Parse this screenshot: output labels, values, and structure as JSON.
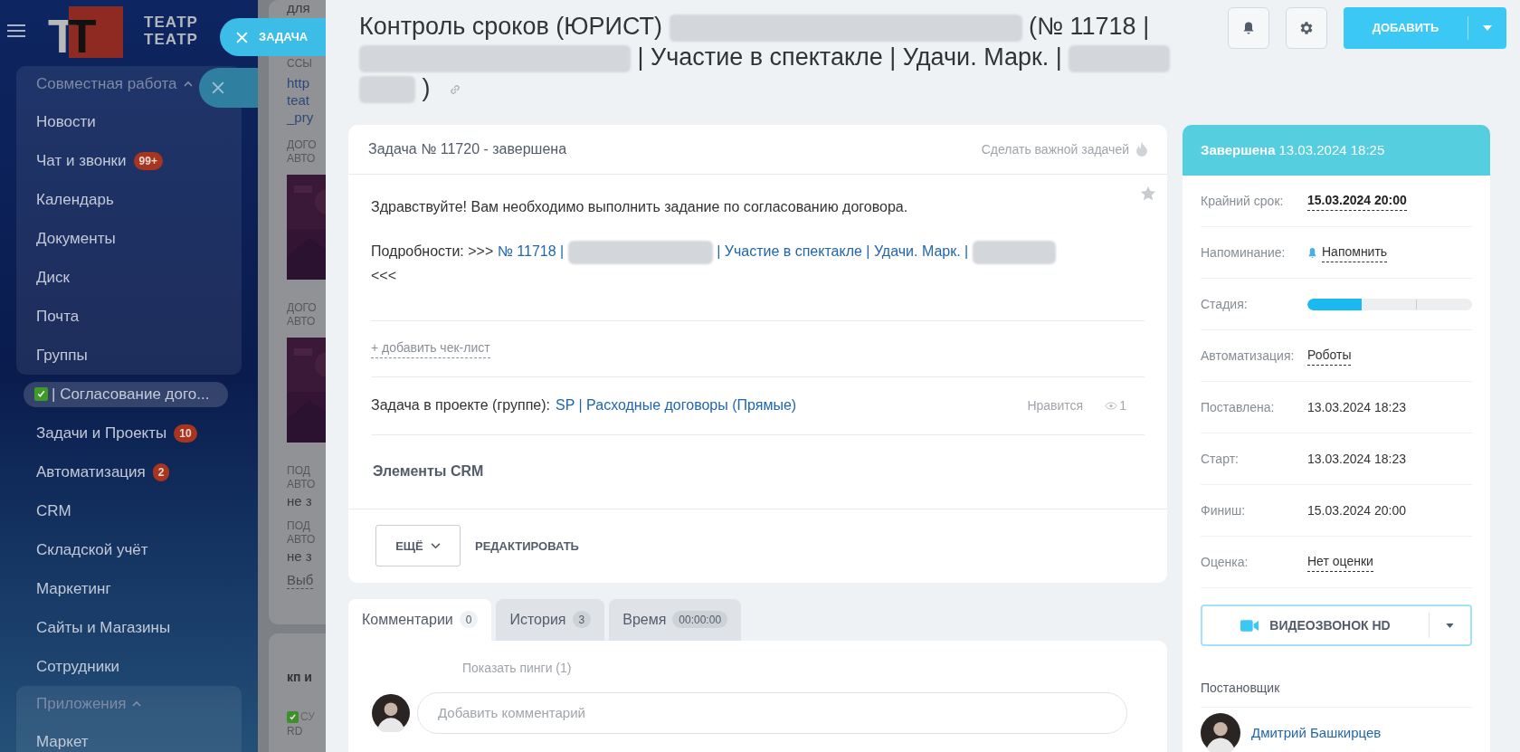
{
  "sidebar": {
    "logo": {
      "letters": [
        "Т",
        "Т"
      ],
      "wordmark": [
        "ТЕАТР",
        "ТЕАТР"
      ]
    },
    "items": [
      {
        "kind": "group",
        "label": "Совместная работа",
        "expanded": true,
        "children": [
          {
            "label": "Новости"
          },
          {
            "label": "Чат и звонки",
            "badge": "99+"
          },
          {
            "label": "Календарь"
          },
          {
            "label": "Документы"
          },
          {
            "label": "Диск"
          },
          {
            "label": "Почта"
          },
          {
            "label": "Группы"
          }
        ]
      },
      {
        "kind": "item",
        "label": "| Согласование дого...",
        "done": true,
        "selected": true
      },
      {
        "kind": "item",
        "label": "Задачи и Проекты",
        "badge": "10",
        "selected": false
      },
      {
        "kind": "item",
        "label": "Автоматизация",
        "badge": "2",
        "selected": false
      },
      {
        "kind": "item",
        "label": "CRM",
        "selected": false
      },
      {
        "kind": "item",
        "label": "Складской учёт",
        "selected": false
      },
      {
        "kind": "item",
        "label": "Маркетинг",
        "selected": false
      },
      {
        "kind": "item",
        "label": "Сайты и Магазины",
        "selected": false
      },
      {
        "kind": "item",
        "label": "Сотрудники",
        "selected": false
      },
      {
        "kind": "group",
        "label": "Приложения",
        "expanded": true,
        "children": [
          {
            "label": "Маркет"
          }
        ]
      }
    ]
  },
  "task_tab": {
    "label": "ЗАДАЧА"
  },
  "background_feed": [
    {
      "kind": "text",
      "text": "для"
    },
    {
      "kind": "caption",
      "text": "ССЫ"
    },
    {
      "kind": "link",
      "text": "http"
    },
    {
      "kind": "link",
      "text": "teat"
    },
    {
      "kind": "link",
      "text": "_pry"
    },
    {
      "kind": "caption",
      "text": "ДОГО"
    },
    {
      "kind": "caption",
      "text": "АВТО"
    },
    {
      "kind": "picture"
    },
    {
      "kind": "caption",
      "text": "ДОГО"
    },
    {
      "kind": "caption",
      "text": "АВТО"
    },
    {
      "kind": "picture"
    },
    {
      "kind": "caption",
      "text": "ПОД"
    },
    {
      "kind": "caption",
      "text": "АВТО"
    },
    {
      "kind": "text",
      "text": "не з"
    },
    {
      "kind": "caption",
      "text": "ПОД"
    },
    {
      "kind": "caption",
      "text": "АВТО"
    },
    {
      "kind": "text",
      "text": "не з"
    },
    {
      "kind": "dashed",
      "text": "Выб"
    },
    {
      "kind": "card_title",
      "text": "кп и"
    },
    {
      "kind": "checked",
      "text": "СУ"
    },
    {
      "kind": "caption",
      "text": "RD"
    }
  ],
  "title": [
    {
      "kind": "text",
      "text": "Контроль сроков (ЮРИСТ)"
    },
    {
      "kind": "redacted"
    },
    {
      "kind": "text",
      "text": "(№ 11718 |"
    },
    {
      "kind": "redacted"
    },
    {
      "kind": "text",
      "text": "| Участие в спектакле | Удачи. Марк. |"
    },
    {
      "kind": "redacted"
    },
    {
      "kind": "redacted"
    },
    {
      "kind": "text",
      "text": ")"
    }
  ],
  "header_buttons": {
    "add": "ДОБАВИТЬ"
  },
  "task": {
    "heading": "Задача № 11720 - завершена",
    "important": "Сделать важной задачей",
    "favorite": false,
    "description": "Здравствуйте! Вам необходимо выполнить задание по согласованию договора.",
    "details": [
      {
        "kind": "text",
        "text": "Подробности: >>>"
      },
      {
        "kind": "link",
        "text": "№ 11718 |"
      },
      {
        "kind": "redacted"
      },
      {
        "kind": "link",
        "text": "| Участие в спектакле | Удачи. Марк. |"
      },
      {
        "kind": "redacted"
      },
      {
        "kind": "text",
        "text": "<<<"
      }
    ],
    "checklist": "+ добавить чек-лист",
    "project_label": "Задача в проекте (группе):",
    "project": "SP | Расходные договоры (Прямые)",
    "like": "Нравится",
    "views": "1",
    "crm": "Элементы CRM",
    "more": "ЕЩЁ",
    "edit": "РЕДАКТИРОВАТЬ"
  },
  "tabs": [
    {
      "label": "Комментарии",
      "count": "0",
      "selected": true
    },
    {
      "label": "История",
      "count": "3",
      "selected": false
    },
    {
      "label": "Время",
      "count": "00:00:00",
      "selected": false
    }
  ],
  "comments": {
    "pings": "Показать пинги (1)",
    "placeholder": "Добавить комментарий"
  },
  "status": {
    "state": "Завершена",
    "date": "13.03.2024 18:25"
  },
  "fields": [
    {
      "kind": "strong_link",
      "label": "Крайний срок:",
      "value": "15.03.2024 20:00"
    },
    {
      "kind": "reminder",
      "label": "Напоминание:",
      "value": "Напомнить"
    },
    {
      "kind": "stage",
      "label": "Стадия:",
      "level": 0.33
    },
    {
      "kind": "link",
      "label": "Автоматизация:",
      "value": "Роботы"
    },
    {
      "kind": "text",
      "label": "Поставлена:",
      "value": "13.03.2024 18:23"
    },
    {
      "kind": "text",
      "label": "Старт:",
      "value": "13.03.2024 18:23"
    },
    {
      "kind": "text",
      "label": "Финиш:",
      "value": "15.03.2024 20:00"
    },
    {
      "kind": "link",
      "label": "Оценка:",
      "value": "Нет оценки"
    }
  ],
  "video_call": "ВИДЕОЗВОНОК HD",
  "creator": {
    "heading": "Постановщик",
    "name": "Дмитрий Башкирцев"
  }
}
